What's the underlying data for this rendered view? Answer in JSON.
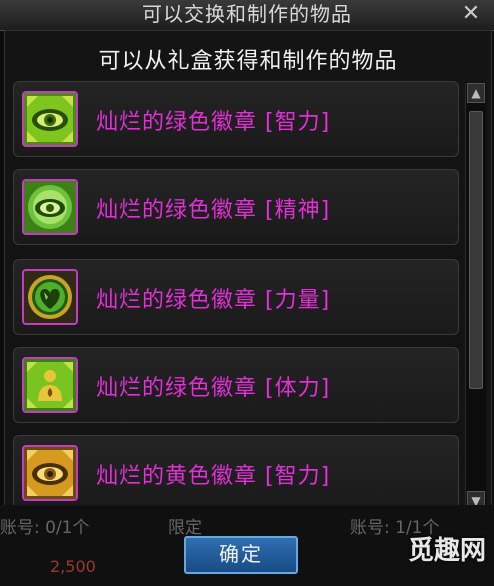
{
  "window": {
    "title": "可以交换和制作的物品",
    "close_glyph": "✕"
  },
  "panel": {
    "subtitle": "可以从礼盒获得和制作的物品"
  },
  "items": [
    {
      "name": "灿烂的绿色徽章 [智力]",
      "icon": "green-eye-emblem-icon",
      "color": "#e22fd8"
    },
    {
      "name": "灿烂的绿色徽章 [精神]",
      "icon": "green-eye-emblem-icon",
      "color": "#e22fd8"
    },
    {
      "name": "灿烂的绿色徽章 [力量]",
      "icon": "green-heart-emblem-icon",
      "color": "#e22fd8"
    },
    {
      "name": "灿烂的绿色徽章 [体力]",
      "icon": "green-figure-emblem-icon",
      "color": "#e22fd8"
    },
    {
      "name": "灿烂的黄色徽章 [智力]",
      "icon": "yellow-eye-emblem-icon",
      "color": "#e22fd8"
    }
  ],
  "scrollbar": {
    "up_glyph": "▲",
    "down_glyph": "▼"
  },
  "background": {
    "left_count": "账号: 0/1个",
    "limit": "限定",
    "right_count": "账号: 1/1个",
    "price": "2,500"
  },
  "confirm_label": "确定",
  "watermark": "觅趣网"
}
